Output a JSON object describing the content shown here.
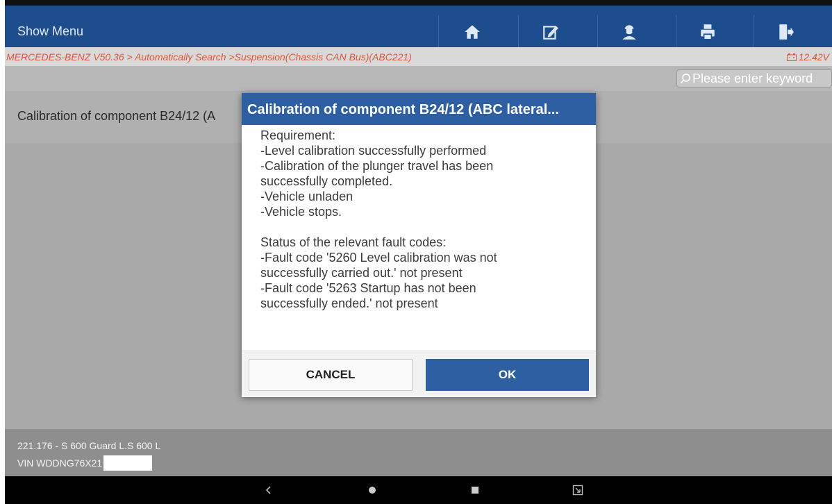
{
  "header": {
    "show_menu_label": "Show Menu",
    "icons": [
      "home-icon",
      "edit-icon",
      "support-icon",
      "print-icon",
      "exit-icon"
    ]
  },
  "breadcrumb": {
    "path": "MERCEDES-BENZ V50.36 > Automatically Search >Suspension(Chassis CAN Bus)(ABC221)",
    "voltage": "12.42V"
  },
  "search": {
    "placeholder": "Please enter keyword"
  },
  "list": {
    "item_label": "Calibration of component B24/12 (A"
  },
  "footer": {
    "model": "221.176 - S 600 Guard L.S 600 L",
    "vin": "VIN WDDNG76X21"
  },
  "dialog": {
    "title": "Calibration of component B24/12 (ABC lateral...",
    "lines": [
      "Requirement:",
      "-Level calibration successfully performed",
      "-Calibration of the plunger travel has been",
      "successfully completed.",
      "-Vehicle unladen",
      "-Vehicle stops.",
      "",
      "Status of the relevant fault codes:",
      "-Fault code '5260 Level calibration was not",
      "successfully carried out.' not present",
      "-Fault code '5263 Startup has not been",
      "successfully ended.' not present"
    ],
    "cancel_label": "CANCEL",
    "ok_label": "OK"
  },
  "colors": {
    "header_bg": "#1d4d8c",
    "accent_red": "#e0553a",
    "button_blue": "#2e5fa3"
  }
}
